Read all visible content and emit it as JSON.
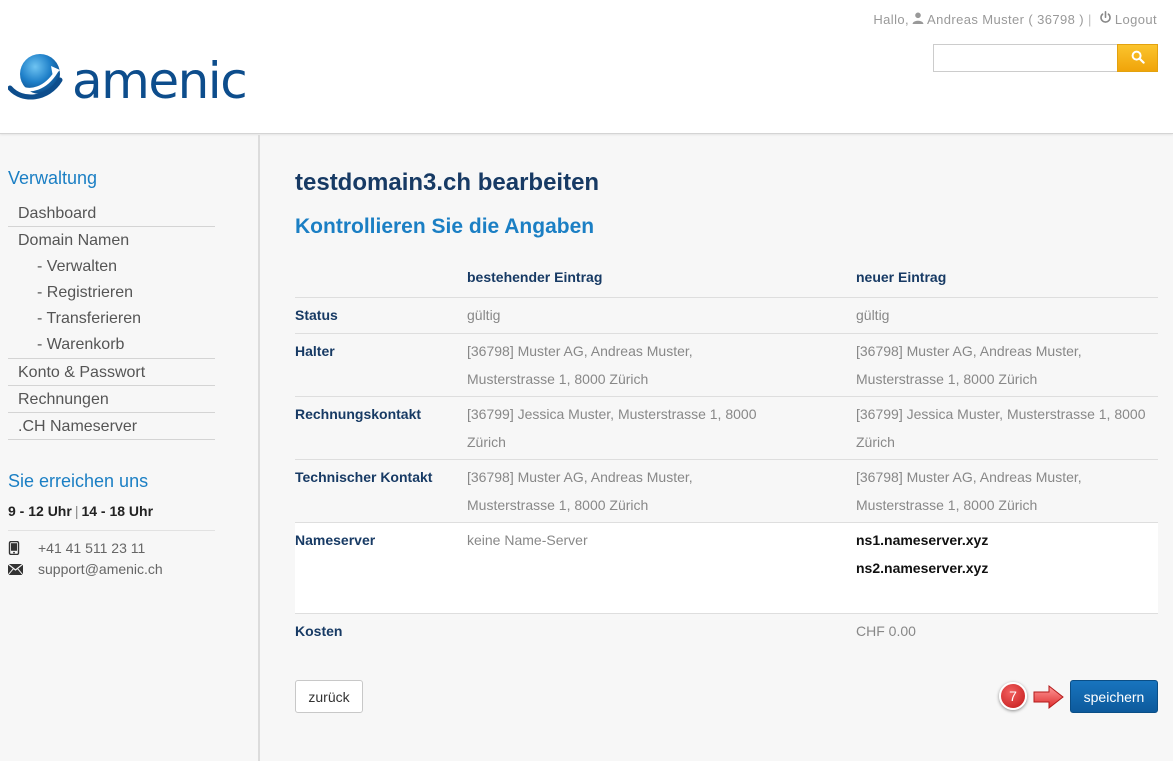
{
  "header": {
    "greeting": "Hallo,",
    "user_name": "Andreas Muster ( 36798 )",
    "separator": "|",
    "logout_label": "Logout",
    "search_placeholder": "",
    "brand": "amenic"
  },
  "sidebar": {
    "admin_title": "Verwaltung",
    "menu": [
      {
        "label": "Dashboard",
        "level": 1
      },
      {
        "label": "Domain Namen",
        "level": 1
      },
      {
        "label": "- Verwalten",
        "level": 2
      },
      {
        "label": "- Registrieren",
        "level": 2
      },
      {
        "label": "- Transferieren",
        "level": 2
      },
      {
        "label": "- Warenkorb",
        "level": 2
      },
      {
        "label": "Konto & Passwort",
        "level": 1
      },
      {
        "label": "Rechnungen",
        "level": 1
      },
      {
        "label": ".CH Nameserver",
        "level": 1
      }
    ],
    "contact_title": "Sie erreichen uns",
    "hours_morning": "9 - 12 Uhr",
    "hours_separator": "|",
    "hours_afternoon": "14 - 18 Uhr",
    "phone": "+41 41 511 23 11",
    "email": "support@amenic.ch"
  },
  "main": {
    "title": "testdomain3.ch bearbeiten",
    "subtitle": "Kontrollieren Sie die Angaben",
    "col_existing": "bestehender Eintrag",
    "col_new": "neuer Eintrag",
    "rows": {
      "status": {
        "label": "Status",
        "old": "gültig",
        "new": "gültig"
      },
      "holder": {
        "label": "Halter",
        "old": "[36798] Muster AG, Andreas Muster, Musterstrasse 1, 8000 Zürich",
        "new": "[36798] Muster AG, Andreas Muster, Musterstrasse 1, 8000 Zürich"
      },
      "billing": {
        "label": "Rechnungskontakt",
        "old": "[36799] Jessica Muster, Musterstrasse 1, 8000 Zürich",
        "new": "[36799] Jessica Muster, Musterstrasse 1, 8000 Zürich"
      },
      "technical": {
        "label": "Technischer Kontakt",
        "old": "[36798] Muster AG, Andreas Muster, Musterstrasse 1, 8000 Zürich",
        "new": "[36798] Muster AG, Andreas Muster, Musterstrasse 1, 8000 Zürich"
      },
      "nameserver": {
        "label": "Nameserver",
        "old": "keine Name-Server",
        "new1": "ns1.nameserver.xyz",
        "new2": "ns2.nameserver.xyz"
      },
      "costs": {
        "label": "Kosten",
        "old": "",
        "new": "CHF 0.00"
      }
    },
    "back_label": "zurück",
    "save_label": "speichern",
    "step_number": "7"
  },
  "colors": {
    "brand_blue": "#0d4d8c",
    "link_blue": "#1b7fc4",
    "heading_navy": "#173a64",
    "search_orange": "#f0a40a",
    "step_red": "#d62b2b"
  }
}
